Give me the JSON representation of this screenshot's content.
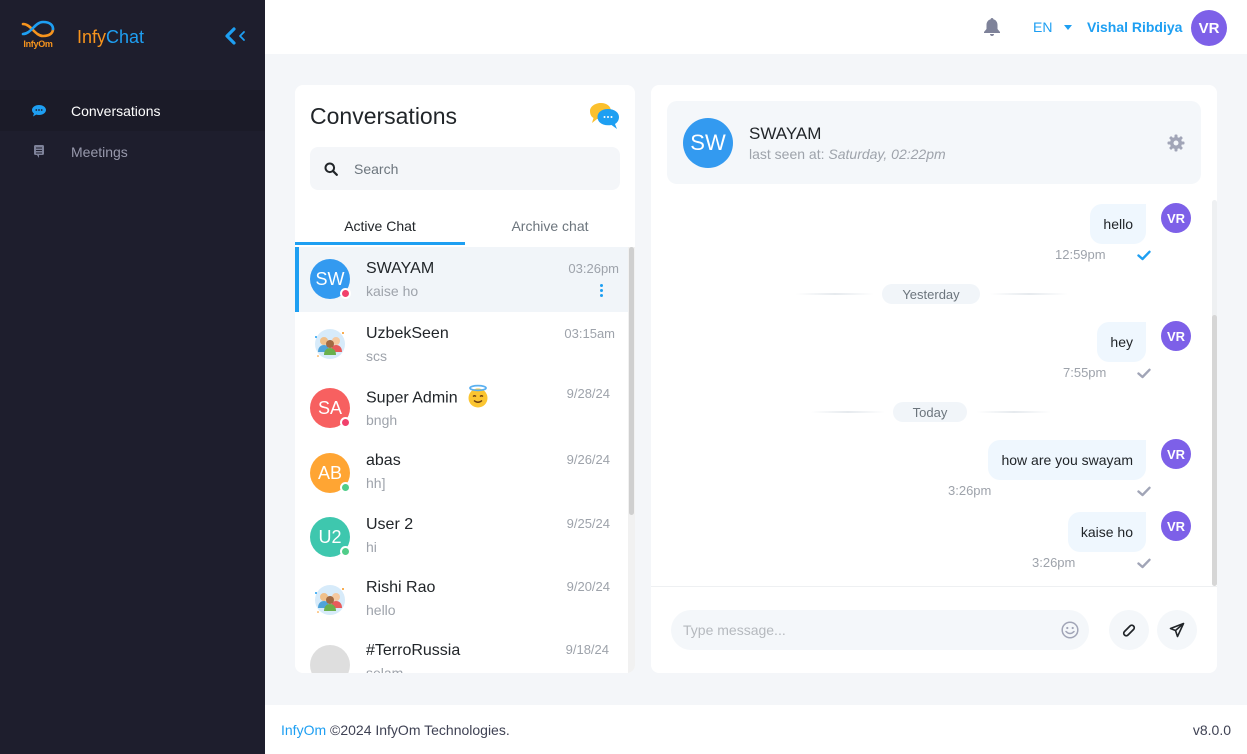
{
  "sidebar": {
    "logo_text": "InfyOm",
    "brand_part1": "Infy",
    "brand_part2": "Chat",
    "collapse_icon": "double-chevron-left-icon",
    "items": [
      {
        "label": "Conversations",
        "icon": "chat-bubble-icon",
        "active": true
      },
      {
        "label": "Meetings",
        "icon": "meeting-icon",
        "active": false
      }
    ]
  },
  "header": {
    "notification_icon": "bell-icon",
    "language": "EN",
    "user_name": "Vishal Ribdiya",
    "user_initials": "VR"
  },
  "conversations": {
    "title": "Conversations",
    "search_placeholder": "Search",
    "tabs": [
      {
        "label": "Active Chat",
        "active": true
      },
      {
        "label": "Archive chat",
        "active": false
      }
    ],
    "items": [
      {
        "name": "SWAYAM",
        "initials": "SW",
        "last_message": "kaise ho",
        "time": "03:26pm",
        "avatar_color": "#339af0",
        "status": "offline",
        "active": true
      },
      {
        "name": "UzbekSeen",
        "initials": "",
        "last_message": "scs",
        "time": "03:15am",
        "avatar_type": "group",
        "status": "none"
      },
      {
        "name": "Super Admin",
        "emoji": "😇",
        "initials": "SA",
        "last_message": "bngh",
        "time": "9/28/24",
        "avatar_color": "#f76060",
        "status": "offline"
      },
      {
        "name": "abas",
        "initials": "AB",
        "last_message": "hh]",
        "time": "9/26/24",
        "avatar_color": "#ffa533",
        "status": "online"
      },
      {
        "name": "User 2",
        "initials": "U2",
        "last_message": "hi",
        "time": "9/25/24",
        "avatar_color": "#3ec7ae",
        "status": "online"
      },
      {
        "name": "Rishi Rao",
        "initials": "",
        "last_message": "hello",
        "time": "9/20/24",
        "avatar_type": "group",
        "status": "none"
      },
      {
        "name": "#TerroRussia",
        "initials": "",
        "last_message": "selam",
        "time": "9/18/24",
        "avatar_color": "#dedede",
        "status": "offline"
      }
    ]
  },
  "chat": {
    "contact_name": "SWAYAM",
    "contact_initials": "SW",
    "last_seen_label": "last seen at: ",
    "last_seen_value": "Saturday, 02:22pm",
    "settings_icon": "gear-icon",
    "dividers": [
      "Yesterday",
      "Today"
    ],
    "messages": [
      {
        "text": "hello",
        "time": "12:59pm",
        "sender": "VR",
        "read": true
      },
      {
        "text": "hey",
        "time": "7:55pm",
        "sender": "VR",
        "read": false
      },
      {
        "text": "how are you swayam",
        "time": "3:26pm",
        "sender": "VR",
        "read": false
      },
      {
        "text": "kaise ho",
        "time": "3:26pm",
        "sender": "VR",
        "read": false
      }
    ],
    "input_placeholder": "Type message...",
    "emoji_icon": "smiley-icon",
    "attach_icon": "paperclip-icon",
    "send_icon": "paper-plane-icon"
  },
  "footer": {
    "brand_link": "InfyOm",
    "copyright": " ©2024 InfyOm Technologies.",
    "version": "v8.0.0"
  },
  "colors": {
    "accent": "#1e9ff2",
    "brand_orange": "#f7941d",
    "sidebar_bg": "#1e1e2d",
    "user_avatar": "#7d60e8",
    "online": "#50cd89",
    "offline": "#f1416c"
  }
}
